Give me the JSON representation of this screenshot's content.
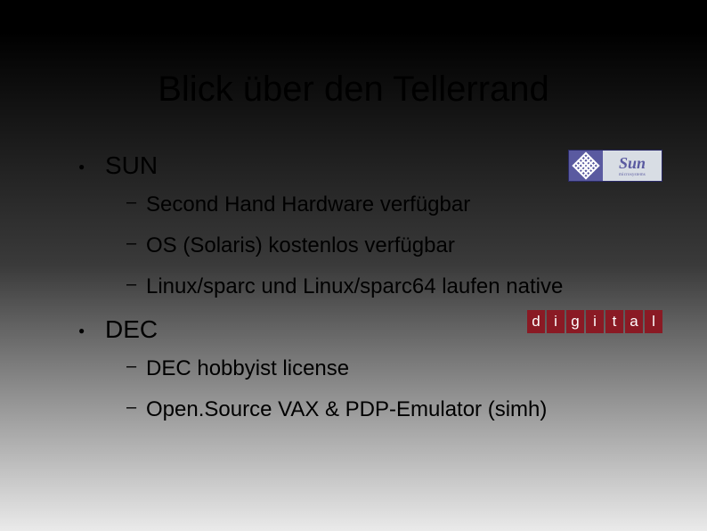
{
  "title": "Blick über den Tellerrand",
  "logos": {
    "sun": {
      "brand": "Sun",
      "tagline": "microsystems"
    },
    "dec": {
      "letters": [
        "d",
        "i",
        "g",
        "i",
        "t",
        "a",
        "l"
      ]
    }
  },
  "bullets": [
    {
      "label": "SUN",
      "sub": [
        "Second Hand Hardware verfügbar",
        "OS (Solaris) kostenlos verfügbar",
        "Linux/sparc und Linux/sparc64 laufen native"
      ]
    },
    {
      "label": "DEC",
      "sub": [
        "DEC hobbyist license",
        "Open.Source VAX & PDP-Emulator (simh)"
      ]
    }
  ]
}
